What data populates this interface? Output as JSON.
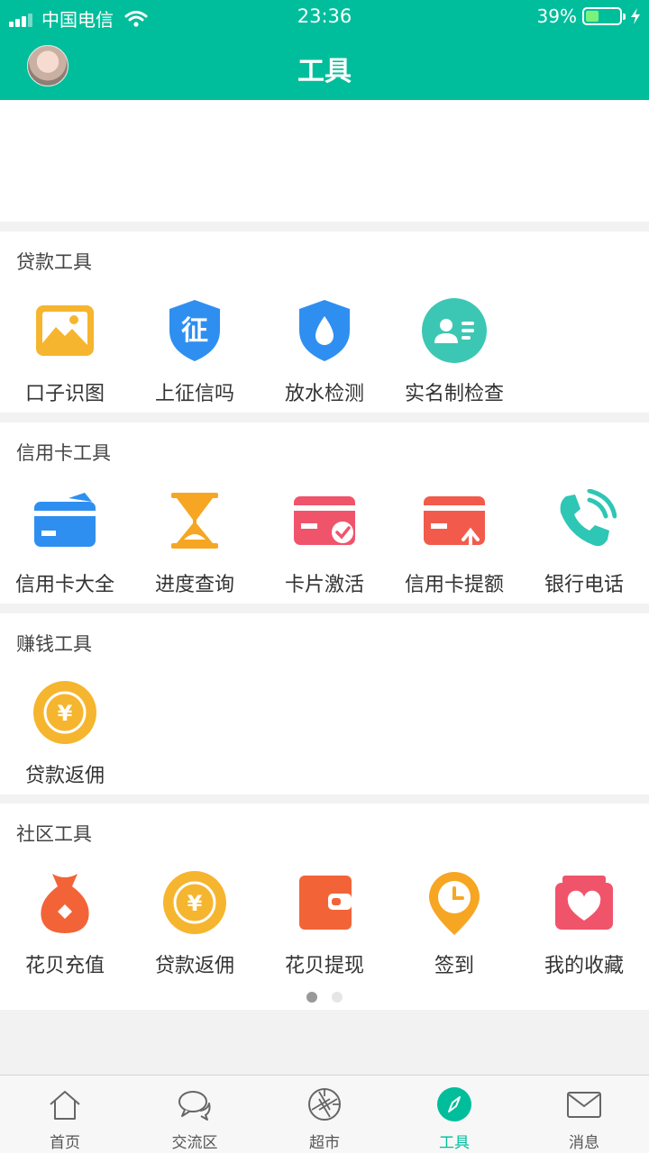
{
  "status_bar": {
    "carrier": "中国电信",
    "time": "23:36",
    "battery": "39%"
  },
  "header": {
    "title": "工具"
  },
  "sections": [
    {
      "title": "贷款工具",
      "items": [
        {
          "label": "口子识图",
          "icon": "image-icon",
          "color": "#f6b52e"
        },
        {
          "label": "上征信吗",
          "icon": "credit-shield-icon",
          "color": "#2f8ff0"
        },
        {
          "label": "放水检测",
          "icon": "water-shield-icon",
          "color": "#2f8ff0"
        },
        {
          "label": "实名制检查",
          "icon": "id-card-icon",
          "color": "#3cc7b4"
        }
      ]
    },
    {
      "title": "信用卡工具",
      "items": [
        {
          "label": "信用卡大全",
          "icon": "credit-card-icon",
          "color": "#2f8ff0"
        },
        {
          "label": "进度查询",
          "icon": "hourglass-icon",
          "color": "#f6a623"
        },
        {
          "label": "卡片激活",
          "icon": "card-check-icon",
          "color": "#f0546b"
        },
        {
          "label": "信用卡提额",
          "icon": "card-up-icon",
          "color": "#f25b4b"
        },
        {
          "label": "银行电话",
          "icon": "phone-icon",
          "color": "#2ec6b4"
        }
      ]
    },
    {
      "title": "赚钱工具",
      "items": [
        {
          "label": "贷款返佣",
          "icon": "yen-coin-icon",
          "color": "#f6b52e"
        }
      ]
    },
    {
      "title": "社区工具",
      "items": [
        {
          "label": "花贝充值",
          "icon": "money-bag-icon",
          "color": "#f26438"
        },
        {
          "label": "贷款返佣",
          "icon": "yen-coin-icon",
          "color": "#f6b52e"
        },
        {
          "label": "花贝提现",
          "icon": "wallet-icon",
          "color": "#f26438"
        },
        {
          "label": "签到",
          "icon": "clock-pin-icon",
          "color": "#f6a623"
        },
        {
          "label": "我的收藏",
          "icon": "heart-folder-icon",
          "color": "#f0546b"
        }
      ]
    }
  ],
  "pagination": {
    "pages": 2,
    "current": 1
  },
  "tabbar": [
    {
      "label": "首页",
      "icon": "home-icon"
    },
    {
      "label": "交流区",
      "icon": "chat-icon"
    },
    {
      "label": "超市",
      "icon": "shutter-icon"
    },
    {
      "label": "工具",
      "icon": "compass-icon",
      "active": true
    },
    {
      "label": "消息",
      "icon": "mail-icon"
    }
  ],
  "colors": {
    "brand": "#00be9b"
  }
}
